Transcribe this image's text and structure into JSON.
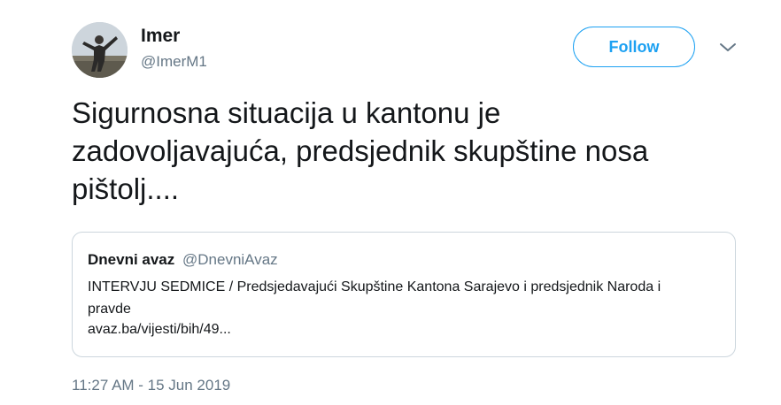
{
  "user": {
    "name": "Imer",
    "handle": "@ImerM1"
  },
  "follow_button": {
    "label": "Follow"
  },
  "menu": {
    "icon": "chevron-down-icon"
  },
  "tweet": {
    "text": "Sigurnosna situacija u kantonu je\nzadovoljavajuća, predsjednik skupštine nosa\npištolj....",
    "timestamp": "11:27 AM - 15 Jun 2019"
  },
  "quote": {
    "author_name": "Dnevni avaz",
    "author_handle": "@DnevniAvaz",
    "text": "INTERVJU SEDMICE / Predsjedavajući Skupštine Kantona Sarajevo i predsjednik Naroda i pravde",
    "link": "avaz.ba/vijesti/bih/49..."
  },
  "colors": {
    "accent": "#1da1f2",
    "text_primary": "#14171a",
    "text_secondary": "#657786",
    "border": "#ccd6dd"
  }
}
